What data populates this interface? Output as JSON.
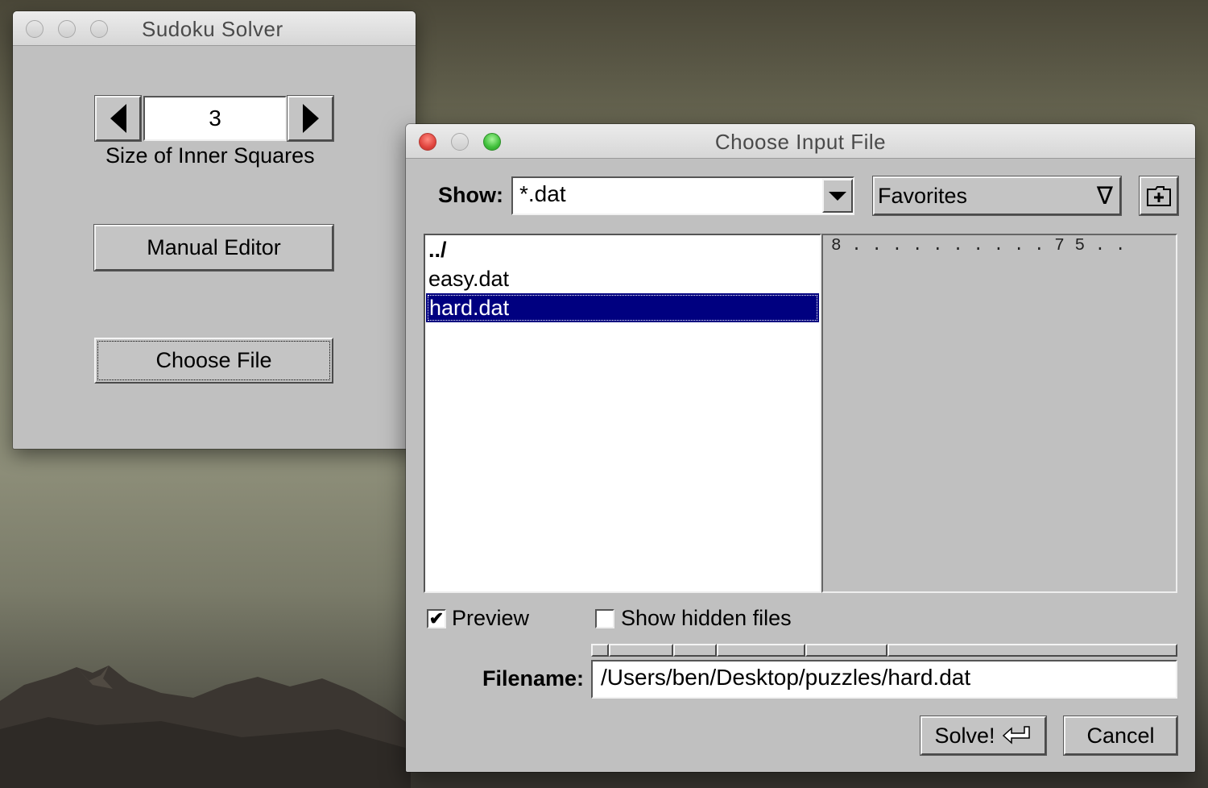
{
  "solver_window": {
    "title": "Sudoku Solver",
    "spinner_value": "3",
    "spinner_label": "Size of Inner Squares",
    "manual_editor_label": "Manual Editor",
    "choose_file_label": "Choose File"
  },
  "file_dialog": {
    "title": "Choose Input File",
    "show_label": "Show:",
    "filter_value": "*.dat",
    "favorites_label": "Favorites",
    "files": [
      {
        "name": "../",
        "selected": false,
        "bold": true
      },
      {
        "name": "easy.dat",
        "selected": false,
        "bold": false
      },
      {
        "name": "hard.dat",
        "selected": true,
        "bold": false
      }
    ],
    "preview_text": "8 . . . . . . . . . . 7 5 . .",
    "preview_checkbox_label": "Preview",
    "preview_checked": true,
    "hidden_checkbox_label": "Show hidden files",
    "hidden_checked": false,
    "check_glyph": "✔",
    "filename_label": "Filename:",
    "filename_value": "/Users/ben/Desktop/puzzles/hard.dat",
    "solve_label": "Solve!",
    "cancel_label": "Cancel"
  },
  "icons": {
    "favorites_arrow": "∇",
    "return_arrow": "return-arrow-icon",
    "new_folder": "new-folder-icon"
  },
  "colors": {
    "selection": "#000080",
    "window_bg": "#c0c0c0"
  }
}
